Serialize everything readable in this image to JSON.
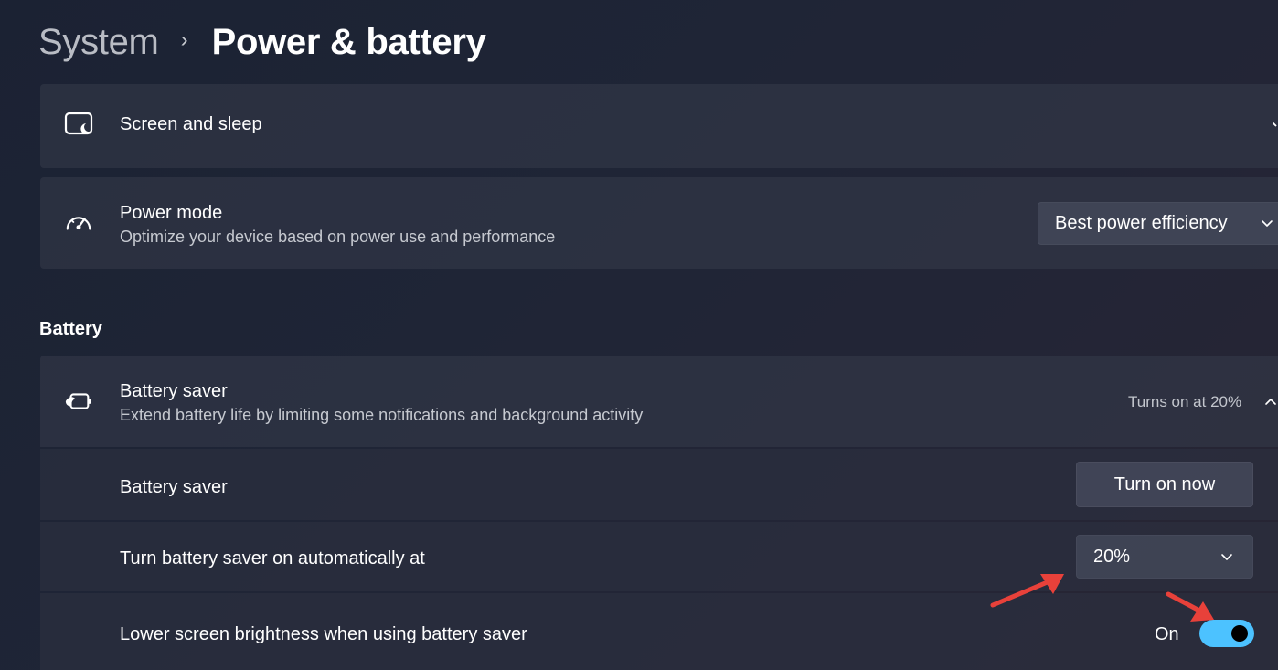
{
  "breadcrumb": {
    "parent": "System",
    "separator": "›",
    "current": "Power & battery"
  },
  "screen_sleep": {
    "title": "Screen and sleep",
    "icon": "screen-sleep-icon",
    "expander": "chevron-down-icon"
  },
  "power_mode": {
    "title": "Power mode",
    "subtitle": "Optimize your device based on power use and performance",
    "icon": "speedometer-icon",
    "selected": "Best power efficiency"
  },
  "section": {
    "battery_label": "Battery"
  },
  "battery_saver": {
    "title": "Battery saver",
    "subtitle": "Extend battery life by limiting some notifications and background activity",
    "icon": "battery-saver-icon",
    "status": "Turns on at 20%",
    "expander": "chevron-up-icon"
  },
  "saver_settings": {
    "turn_on_row_title": "Battery saver",
    "turn_on_button": "Turn on now",
    "auto_row_title": "Turn battery saver on automatically at",
    "auto_selected": "20%",
    "brightness_row_title": "Lower screen brightness when using battery saver",
    "brightness_state": "On",
    "brightness_enabled": true
  },
  "colors": {
    "accent": "#4cc2ff",
    "annotation_arrow": "#e8413a"
  }
}
